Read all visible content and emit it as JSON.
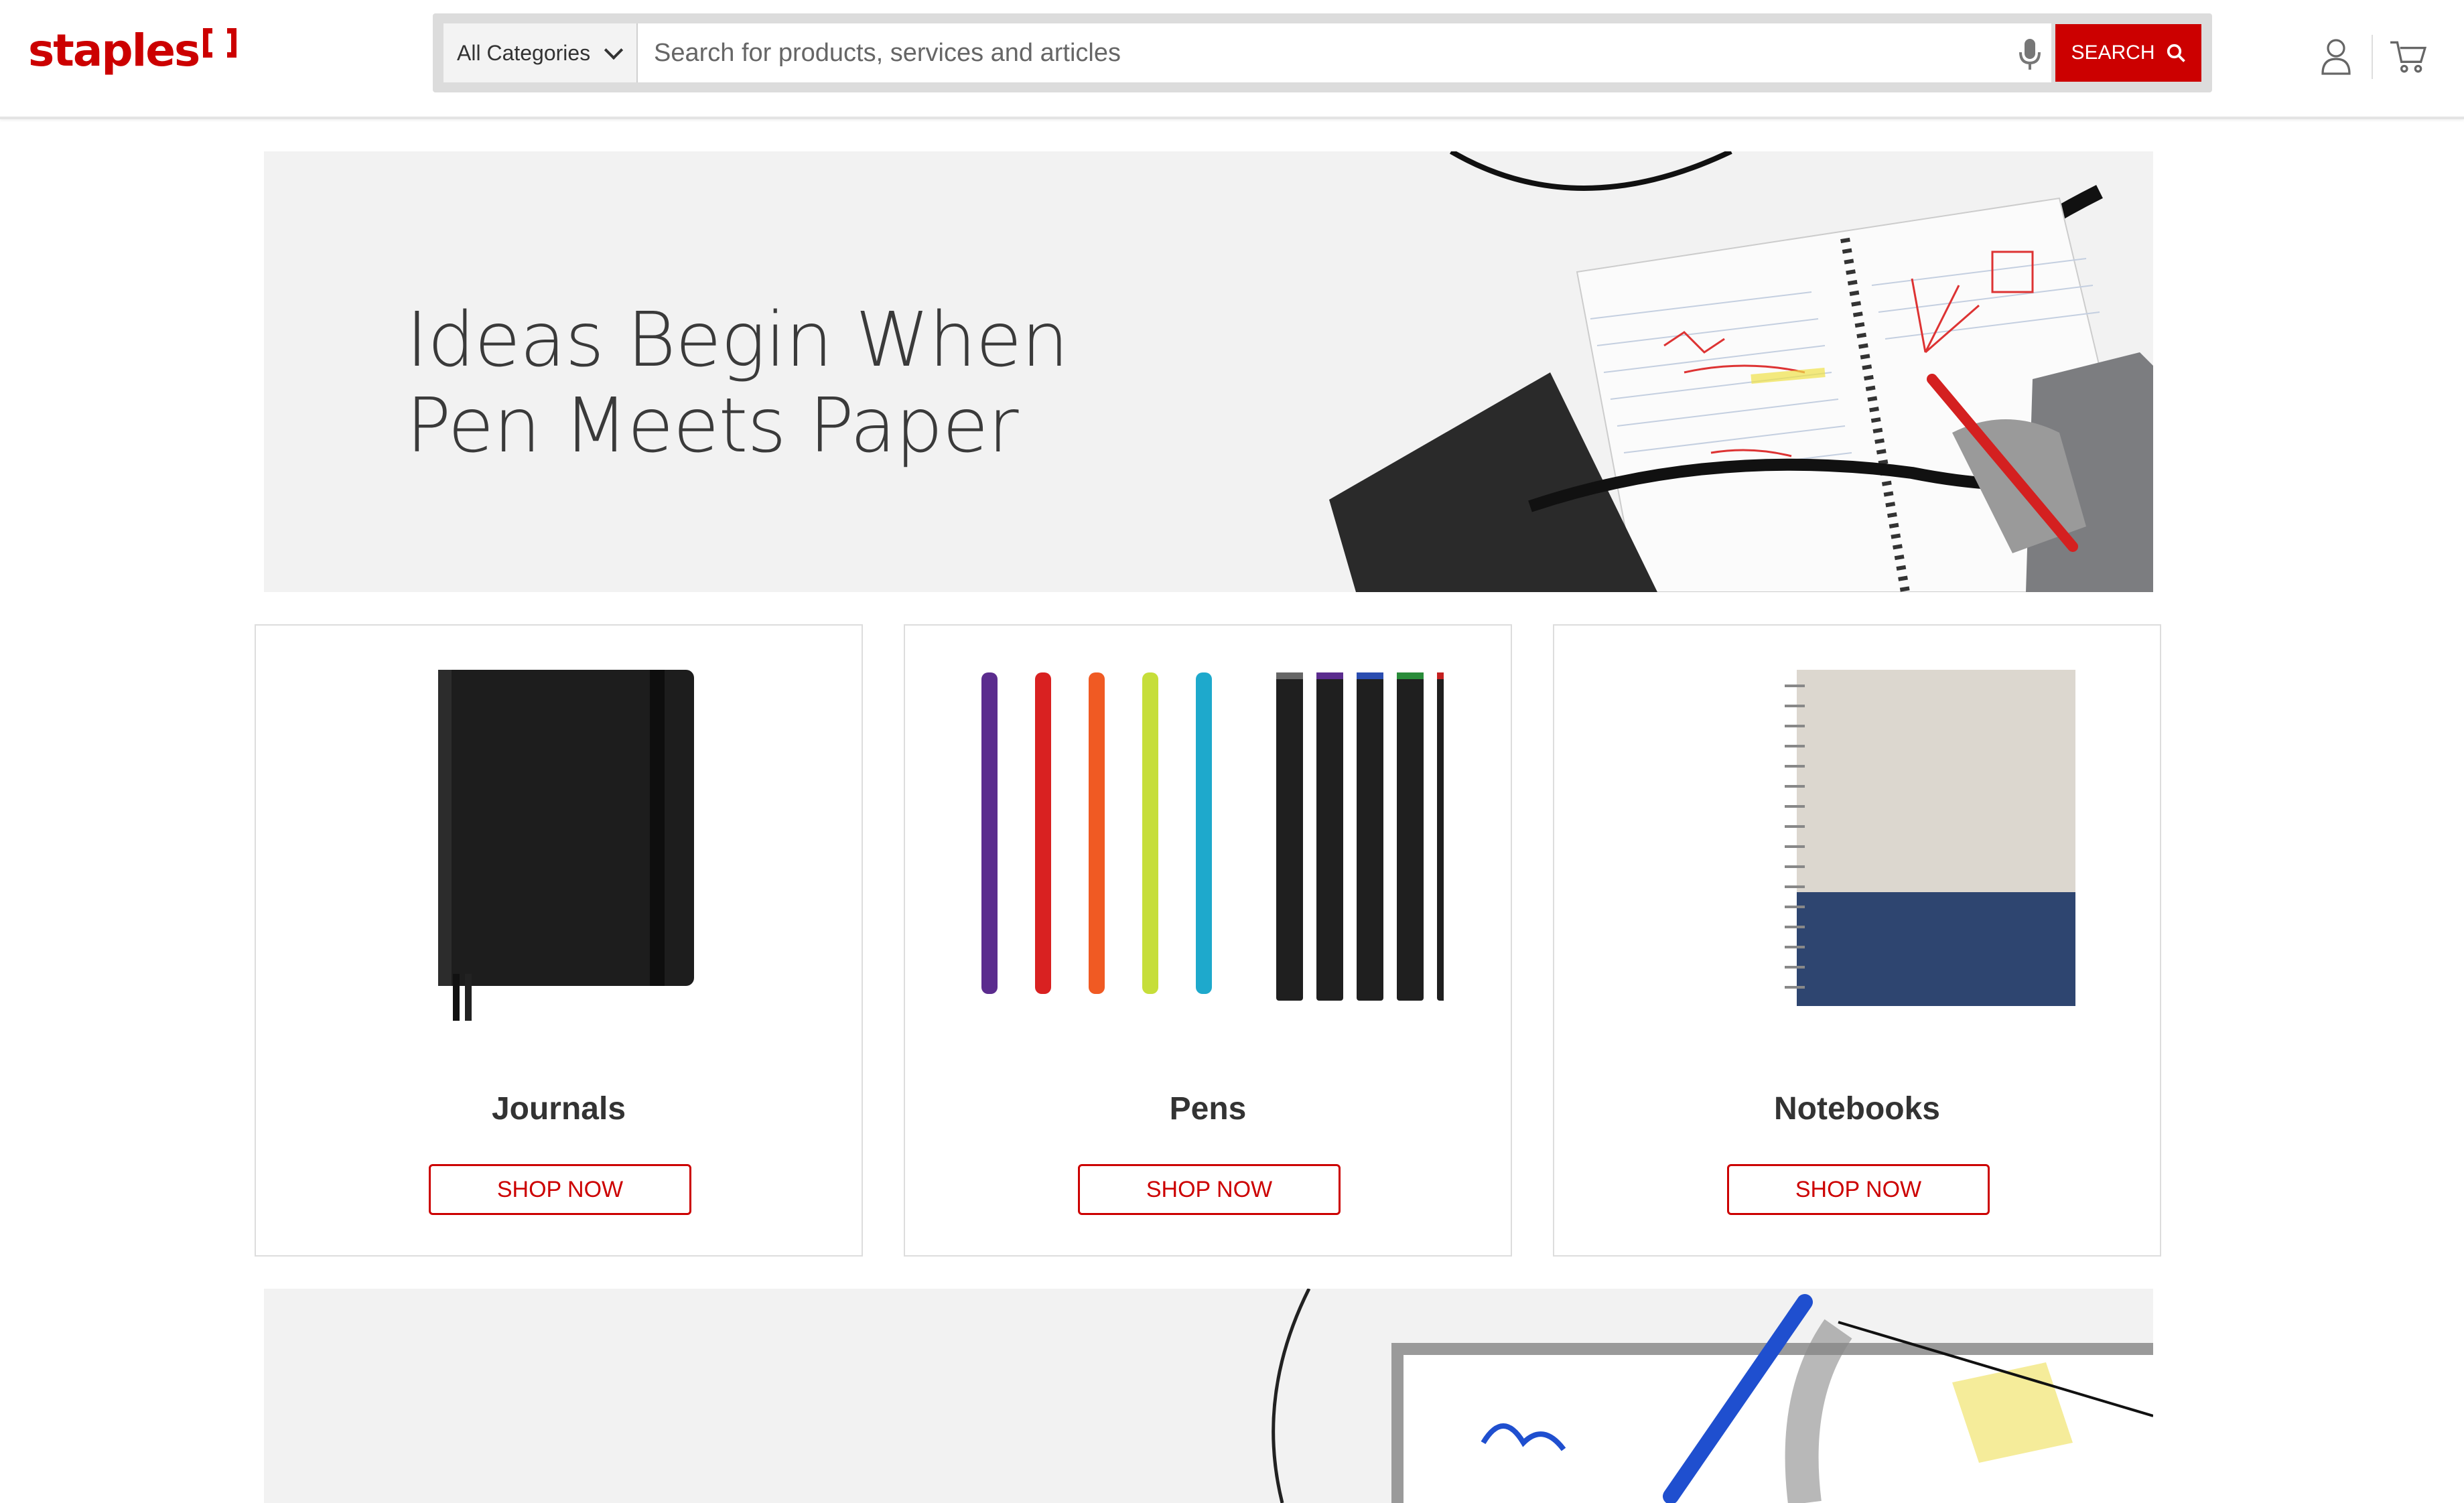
{
  "header": {
    "logo_text": "staples",
    "category_select": "All Categories",
    "search_placeholder": "Search for products, services and articles",
    "search_button": "SEARCH"
  },
  "hero": {
    "line1": "Ideas Begin When",
    "line2": "Pen Meets Paper"
  },
  "categories": [
    {
      "title": "Journals",
      "cta": "SHOP NOW"
    },
    {
      "title": "Pens",
      "cta": "SHOP NOW"
    },
    {
      "title": "Notebooks",
      "cta": "SHOP NOW"
    }
  ],
  "colors": {
    "brand_red": "#cc0000",
    "banner_bg": "#f2f2f2"
  },
  "icons": [
    "chevron-down-icon",
    "microphone-icon",
    "search-icon",
    "account-icon",
    "cart-icon"
  ]
}
